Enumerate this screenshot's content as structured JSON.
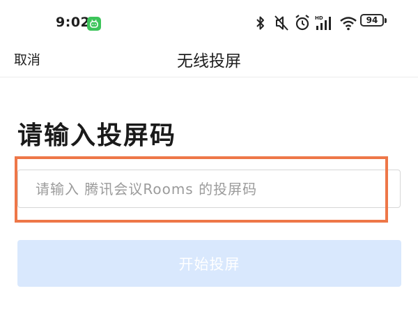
{
  "status_bar": {
    "time": "9:02",
    "battery": "94",
    "network_label": "HD"
  },
  "nav": {
    "cancel_label": "取消",
    "title": "无线投屏"
  },
  "main": {
    "heading": "请输入投屏码",
    "input_placeholder": "请输入 腾讯会议Rooms 的投屏码",
    "input_value": "",
    "start_button_label": "开始投屏"
  },
  "colors": {
    "highlight": "#ee7748",
    "button_disabled_bg": "#d9e8fd",
    "app_badge": "#3cc45a"
  },
  "icons": [
    "bluetooth-icon",
    "mute-icon",
    "alarm-icon",
    "signal-icon",
    "wifi-icon",
    "battery-icon",
    "app-notification-icon"
  ]
}
